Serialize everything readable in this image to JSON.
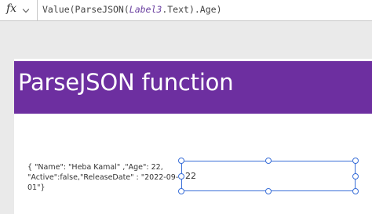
{
  "formula_bar": {
    "icon": "fx-icon",
    "function_prefix": "Value(ParseJSON(",
    "control_name": "Label3",
    "function_suffix": ".Text).Age)"
  },
  "screen": {
    "title": "ParseJSON function",
    "title_background": "#6d2fa0",
    "json_label_text": "{ \"Name\": \"Heba Kamal\" ,\"Age\": 22, \"Active\":false,\"ReleaseDate\" : \"2022-09-01\"}",
    "age_label_value": "22"
  }
}
